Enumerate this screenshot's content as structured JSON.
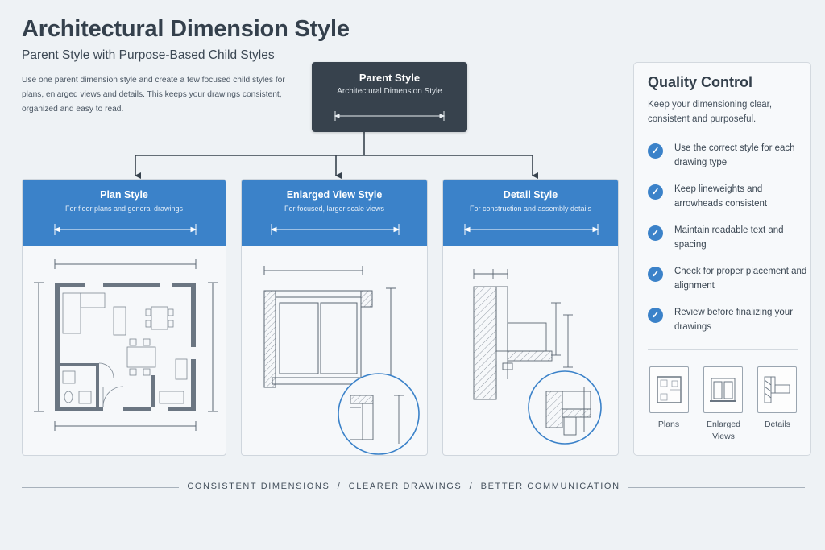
{
  "header": {
    "title": "Architectural Dimension Style",
    "subtitle": "Parent Style with Purpose-Based Child Styles",
    "intro": "Use one parent dimension style and create a few focused child styles for plans, enlarged views and details. This keeps your drawings consistent, organized and easy to read."
  },
  "parent": {
    "title": "Parent Style",
    "subtitle": "Architectural Dimension Style"
  },
  "children": [
    {
      "title": "Plan Style",
      "subtitle": "For floor plans and general drawings"
    },
    {
      "title": "Enlarged View Style",
      "subtitle": "For focused, larger scale views"
    },
    {
      "title": "Detail Style",
      "subtitle": "For construction and assembly details"
    }
  ],
  "quality_control": {
    "title": "Quality Control",
    "description": "Keep your dimensioning clear, consistent and purposeful.",
    "items": [
      {
        "text": "Use the correct style for each drawing type"
      },
      {
        "text": "Keep lineweights and arrowheads consistent"
      },
      {
        "text": "Maintain readable text and spacing"
      },
      {
        "text": "Check for proper placement and alignment"
      },
      {
        "text": "Review before finalizing your drawings"
      }
    ],
    "thumbnails": [
      {
        "label": "Plans"
      },
      {
        "label": "Enlarged Views"
      },
      {
        "label": "Details"
      }
    ]
  },
  "footer": {
    "tagline": "CONSISTENT DIMENSIONS  /  CLEARER DRAWINGS  /  BETTER COMMUNICATION"
  },
  "colors": {
    "accent": "#3b82c9",
    "parent_box": "#37424d",
    "background": "#eef2f5"
  }
}
